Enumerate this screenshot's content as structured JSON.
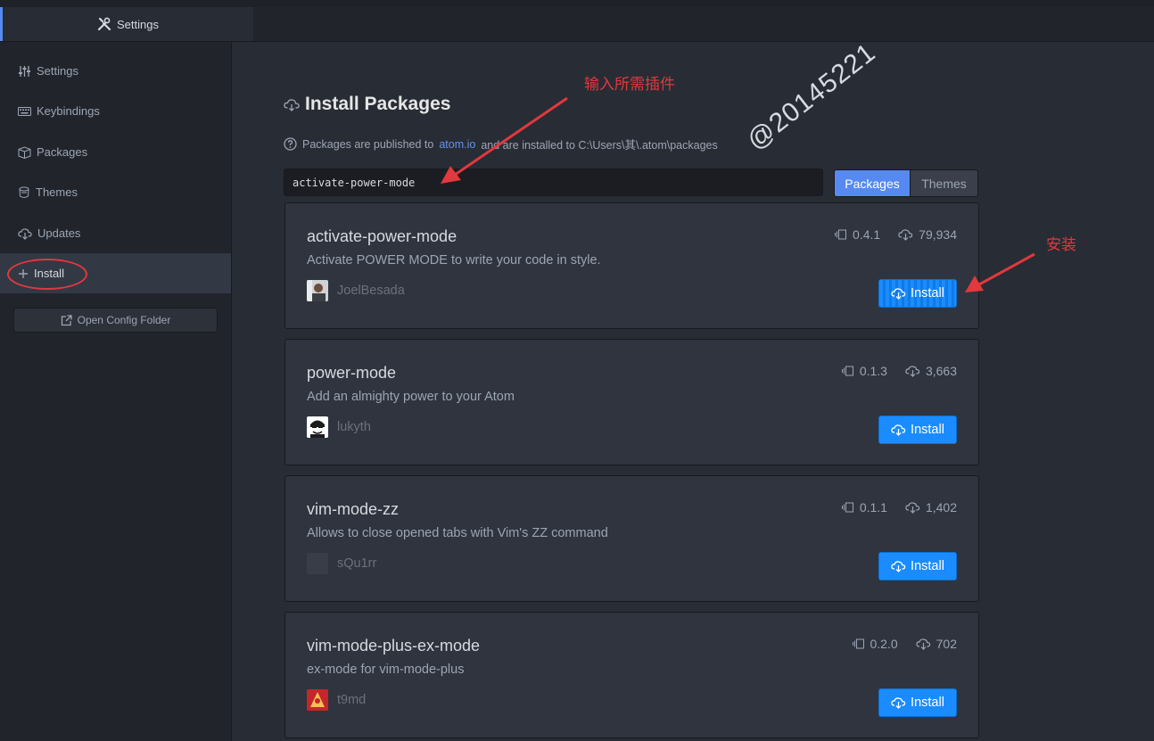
{
  "tab": {
    "title": "Settings"
  },
  "sidebar": {
    "items": [
      {
        "label": "Settings"
      },
      {
        "label": "Keybindings"
      },
      {
        "label": "Packages"
      },
      {
        "label": "Themes"
      },
      {
        "label": "Updates"
      },
      {
        "label": "Install",
        "active": true
      }
    ],
    "config_button": "Open Config Folder"
  },
  "main": {
    "title": "Install Packages",
    "hint_before": "Packages are published to",
    "hint_link": "atom.io",
    "hint_after": "and are installed to C:\\Users\\其\\.atom\\packages",
    "search_value": "activate-power-mode",
    "toggle": {
      "packages": "Packages",
      "themes": "Themes",
      "selected": "Packages"
    },
    "packages": [
      {
        "name": "activate-power-mode",
        "description": "Activate POWER MODE to write your code in style.",
        "author": "JoelBesada",
        "version": "0.4.1",
        "downloads": "79,934",
        "button": "Install"
      },
      {
        "name": "power-mode",
        "description": "Add an almighty power to your Atom",
        "author": "lukyth",
        "version": "0.1.3",
        "downloads": "3,663",
        "button": "Install"
      },
      {
        "name": "vim-mode-zz",
        "description": "Allows to close opened tabs with Vim's ZZ command",
        "author": "sQu1rr",
        "version": "0.1.1",
        "downloads": "1,402",
        "button": "Install"
      },
      {
        "name": "vim-mode-plus-ex-mode",
        "description": "ex-mode for vim-mode-plus",
        "author": "t9md",
        "version": "0.2.0",
        "downloads": "702",
        "button": "Install"
      }
    ]
  },
  "annotations": {
    "input_hint": "输入所需插件",
    "install_hint": "安装",
    "watermark": "@20145221",
    "color": "#e0393e"
  },
  "colors": {
    "accent": "#568af2",
    "install": "#1a8cff"
  }
}
